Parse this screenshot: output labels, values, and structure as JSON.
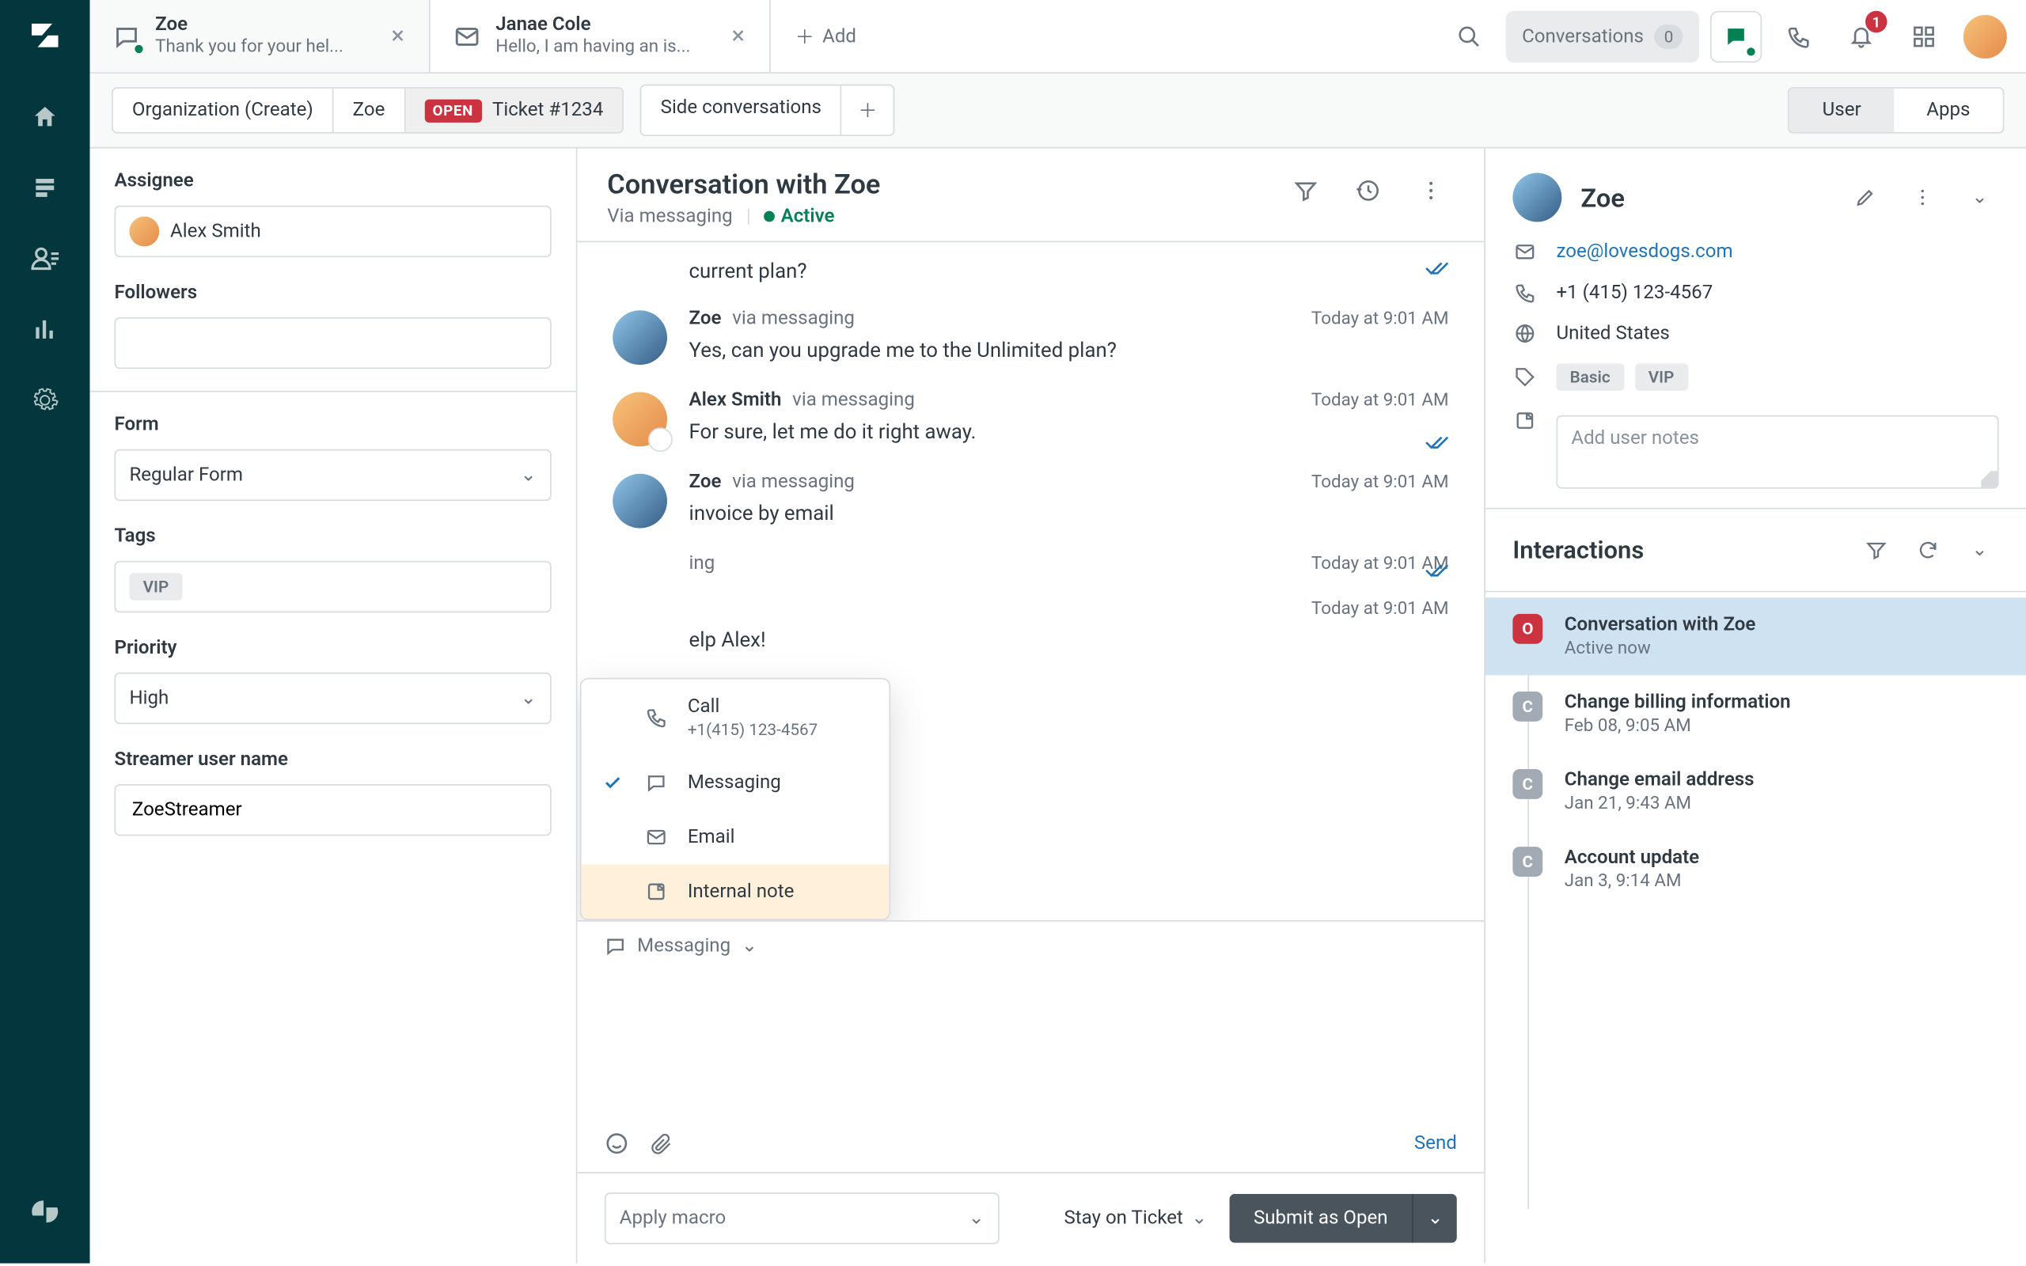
{
  "tabs": [
    {
      "kind": "messaging",
      "title": "Zoe",
      "subtitle": "Thank you for your hel...",
      "active": true
    },
    {
      "kind": "email",
      "title": "Janae Cole",
      "subtitle": "Hello, I am having an is...",
      "active": false
    }
  ],
  "add_tab_label": "Add",
  "top": {
    "conversations_label": "Conversations",
    "conversations_count": "0",
    "notifications_count": "1"
  },
  "context": {
    "crumbs": [
      "Organization (Create)",
      "Zoe"
    ],
    "ticket_status": "OPEN",
    "ticket_label": "Ticket #1234",
    "side_conversations": "Side conversations",
    "right_tabs": [
      "User",
      "Apps"
    ],
    "right_active": "User"
  },
  "left_panel": {
    "assignee_label": "Assignee",
    "assignee_value": "Alex Smith",
    "followers_label": "Followers",
    "form_label": "Form",
    "form_value": "Regular Form",
    "tags_label": "Tags",
    "tags": [
      "VIP"
    ],
    "priority_label": "Priority",
    "priority_value": "High",
    "streamer_label": "Streamer user name",
    "streamer_value": "ZoeStreamer"
  },
  "conversation": {
    "title": "Conversation with Zoe",
    "via": "Via messaging",
    "status": "Active",
    "partial_first_line": "current plan?",
    "messages": [
      {
        "author": "Zoe",
        "avatar": "zoe",
        "via": "via messaging",
        "time": "Today at 9:01 AM",
        "text": "Yes, can you upgrade me to the Unlimited plan?",
        "check": false
      },
      {
        "author": "Alex Smith",
        "avatar": "alex",
        "via": "via messaging",
        "time": "Today at 9:01 AM",
        "text": "For sure, let me do it right away.",
        "check": true
      },
      {
        "author": "Zoe",
        "avatar": "zoe",
        "via": "via messaging",
        "time": "Today at 9:01 AM",
        "text": "invoice by email",
        "check": false,
        "obscured_prefix": true
      },
      {
        "author": "",
        "avatar": "",
        "via": "ing",
        "time": "Today at 9:01 AM",
        "text": "",
        "check": true,
        "obscured_prefix": true
      },
      {
        "author": "",
        "avatar": "",
        "via": "",
        "time": "Today at 9:01 AM",
        "text": "elp Alex!",
        "check": false,
        "obscured_prefix": true
      }
    ]
  },
  "channel_popover": {
    "selected": "Messaging",
    "items": [
      {
        "key": "call",
        "label": "Call",
        "sub": "+1(415) 123-4567"
      },
      {
        "key": "messaging",
        "label": "Messaging"
      },
      {
        "key": "email",
        "label": "Email"
      },
      {
        "key": "internal",
        "label": "Internal note",
        "highlight": true
      }
    ]
  },
  "composer": {
    "channel_label": "Messaging",
    "send_label": "Send",
    "macro_placeholder": "Apply macro",
    "stay_label": "Stay on Ticket",
    "submit_label": "Submit as Open"
  },
  "user": {
    "name": "Zoe",
    "email": "zoe@lovesdogs.com",
    "phone": "+1 (415) 123-4567",
    "location": "United States",
    "tags": [
      "Basic",
      "VIP"
    ],
    "notes_placeholder": "Add user notes"
  },
  "interactions": {
    "title": "Interactions",
    "items": [
      {
        "status": "open",
        "letter": "O",
        "title": "Conversation with Zoe",
        "sub": "Active now",
        "selected": true
      },
      {
        "status": "closed",
        "letter": "C",
        "title": "Change billing information",
        "sub": "Feb 08, 9:05 AM"
      },
      {
        "status": "closed",
        "letter": "C",
        "title": "Change email address",
        "sub": "Jan 21, 9:43 AM"
      },
      {
        "status": "closed",
        "letter": "C",
        "title": "Account update",
        "sub": "Jan 3, 9:14 AM"
      }
    ]
  }
}
